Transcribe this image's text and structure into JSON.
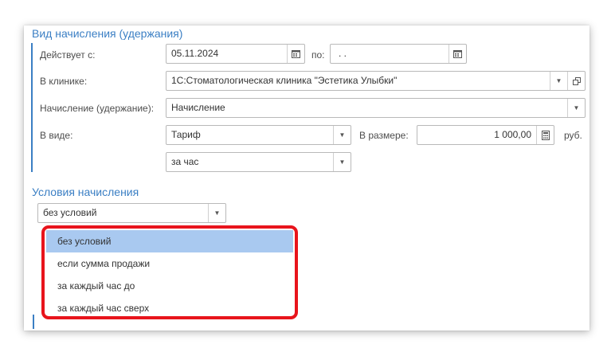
{
  "section1": {
    "title": "Вид начисления (удержания)"
  },
  "row_date": {
    "label": "Действует с:",
    "date_from": "05.11.2024",
    "to_label": "по:",
    "date_to": " .  . "
  },
  "row_clinic": {
    "label": "В клинике:",
    "value": "1С:Стоматологическая клиника \"Эстетика Улыбки\""
  },
  "row_accrual": {
    "label": "Начисление (удержание):",
    "value": "Начисление"
  },
  "row_kind": {
    "label": "В виде:",
    "value": "Тариф",
    "amount_label": "В размере:",
    "amount": "1 000,00",
    "currency": "руб."
  },
  "row_period": {
    "value": "за час"
  },
  "section2": {
    "title": "Условия начисления"
  },
  "conditions": {
    "value": "без условий",
    "options": [
      "без условий",
      "если сумма продажи",
      "за каждый час до",
      "за каждый час сверх"
    ],
    "selected_index": 0
  },
  "colors": {
    "accent": "#3b7fc4",
    "highlight": "#e8141c",
    "selected_option": "#a9c9f0"
  },
  "icons": [
    "calendar-icon",
    "chevron-down-icon",
    "open-window-icon"
  ]
}
